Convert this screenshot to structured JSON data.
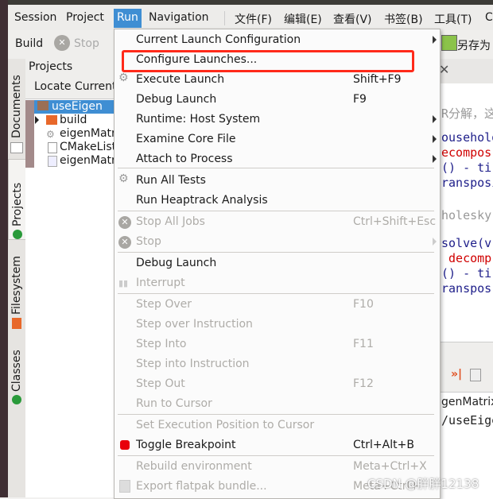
{
  "menubar": [
    "Session",
    "Project",
    "Run",
    "Navigation",
    "文件(F)",
    "编辑(E)",
    "查看(V)",
    "书签(B)",
    "工具(T)",
    "C"
  ],
  "toolbar": {
    "build": "Build",
    "stop": "Stop",
    "save_as": "另存为"
  },
  "sidetabs": [
    "Documents",
    "Projects",
    "Filesystem",
    "Classes"
  ],
  "projects": {
    "title": "Projects",
    "locate": "Locate Current",
    "tree": [
      "useEigen",
      "build",
      "eigenMatrix",
      "CMakeLists",
      "eigenMatrix"
    ]
  },
  "menu": {
    "items": [
      {
        "label": "Current Launch Configuration",
        "shortcut": "",
        "submenu": true,
        "disabled": false,
        "icon": ""
      },
      {
        "label": "Configure Launches...",
        "shortcut": "",
        "disabled": false,
        "icon": "",
        "highlighted": true
      },
      {
        "label": "Execute Launch",
        "shortcut": "Shift+F9",
        "disabled": false,
        "icon": "gears-icon"
      },
      {
        "label": "Debug Launch",
        "shortcut": "F9",
        "disabled": false,
        "icon": ""
      },
      {
        "label": "Runtime: Host System",
        "shortcut": "",
        "submenu": true,
        "disabled": false,
        "icon": ""
      },
      {
        "label": "Examine Core File",
        "shortcut": "",
        "submenu": true,
        "disabled": false,
        "icon": ""
      },
      {
        "label": "Attach to Process",
        "shortcut": "",
        "submenu": true,
        "disabled": false,
        "icon": ""
      },
      {
        "label": "Run All Tests",
        "shortcut": "",
        "disabled": false,
        "icon": "gears-icon"
      },
      {
        "label": "Run Heaptrack Analysis",
        "shortcut": "",
        "disabled": false,
        "icon": ""
      },
      {
        "label": "Stop All Jobs",
        "shortcut": "Ctrl+Shift+Esc",
        "disabled": true,
        "icon": "stop-icon"
      },
      {
        "label": "Stop",
        "shortcut": "",
        "submenu": true,
        "disabled": true,
        "icon": "stop-icon"
      },
      {
        "label": "Debug Launch",
        "shortcut": "",
        "disabled": false,
        "icon": ""
      },
      {
        "label": "Interrupt",
        "shortcut": "",
        "disabled": true,
        "icon": "pause-icon"
      },
      {
        "label": "Step Over",
        "shortcut": "F10",
        "disabled": true,
        "icon": ""
      },
      {
        "label": "Step over Instruction",
        "shortcut": "",
        "disabled": true,
        "icon": ""
      },
      {
        "label": "Step Into",
        "shortcut": "F11",
        "disabled": true,
        "icon": ""
      },
      {
        "label": "Step into Instruction",
        "shortcut": "",
        "disabled": true,
        "icon": ""
      },
      {
        "label": "Step Out",
        "shortcut": "F12",
        "disabled": true,
        "icon": ""
      },
      {
        "label": "Run to Cursor",
        "shortcut": "",
        "disabled": true,
        "icon": ""
      },
      {
        "label": "Set Execution Position to Cursor",
        "shortcut": "",
        "disabled": true,
        "icon": ""
      },
      {
        "label": "Toggle Breakpoint",
        "shortcut": "Ctrl+Alt+B",
        "disabled": false,
        "icon": "breakpoint-icon"
      },
      {
        "label": "Rebuild environment",
        "shortcut": "Meta+Ctrl+X",
        "disabled": true,
        "icon": ""
      },
      {
        "label": "Export flatpak bundle...",
        "shortcut": "Meta+Ctrl+",
        "disabled": true,
        "icon": "export-icon"
      }
    ]
  },
  "editor": {
    "lines": [
      "R分解，这",
      "",
      "ouseholder",
      "ecompos",
      "() - ti",
      "ransposi",
      "",
      "holesky",
      "",
      "solve(v",
      " decomp",
      "() - ti",
      "ranspos"
    ]
  },
  "bottom": {
    "lines": [
      "genMatrix",
      "/useEige"
    ]
  },
  "watermark": "CSDN @胖胖12138",
  "colors": {
    "accent": "#3f8ed3",
    "highlight_box": "#ff2a1a",
    "breakpoint": "#e8000b"
  }
}
